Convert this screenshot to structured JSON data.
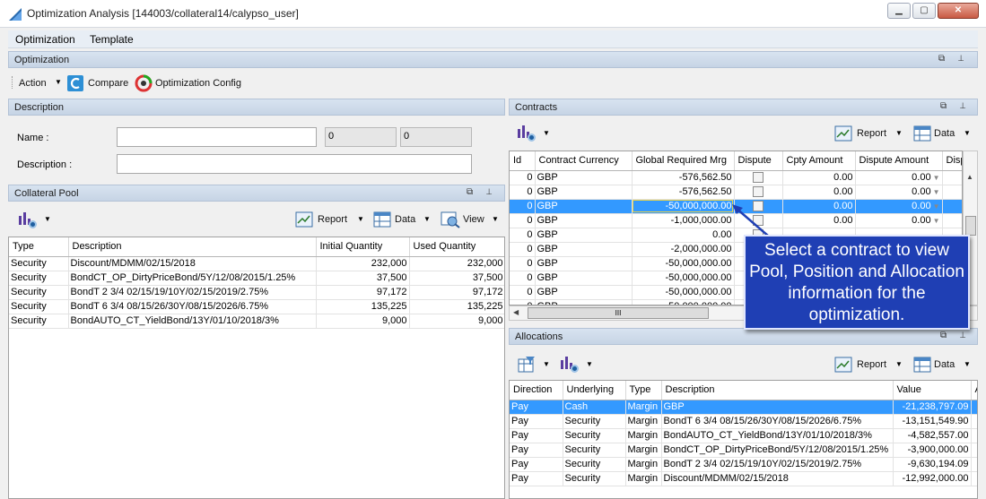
{
  "window": {
    "title": "Optimization Analysis [144003/collateral14/calypso_user]",
    "min_label": "▁",
    "restore_label": "▢",
    "close_label": "✕"
  },
  "menu": [
    "Optimization",
    "Template"
  ],
  "optimization_panel": {
    "header": "Optimization",
    "action_label": "Action",
    "compare_label": "Compare",
    "config_label": "Optimization Config"
  },
  "description_panel": {
    "header": "Description",
    "name_label": "Name :",
    "name_value": "",
    "field_a": "0",
    "field_b": "0",
    "description_label": "Description :",
    "description_value": ""
  },
  "collateral_pool": {
    "header": "Collateral Pool",
    "report_label": "Report",
    "data_label": "Data",
    "view_label": "View",
    "columns": [
      "Type",
      "Description",
      "Initial Quantity",
      "Used Quantity"
    ],
    "rows": [
      [
        "Security",
        "Discount/MDMM/02/15/2018",
        "232,000",
        "232,000"
      ],
      [
        "Security",
        "BondCT_OP_DirtyPriceBond/5Y/12/08/2015/1.25%",
        "37,500",
        "37,500"
      ],
      [
        "Security",
        "BondT 2 3/4 02/15/19/10Y/02/15/2019/2.75%",
        "97,172",
        "97,172"
      ],
      [
        "Security",
        "BondT 6 3/4 08/15/26/30Y/08/15/2026/6.75%",
        "135,225",
        "135,225"
      ],
      [
        "Security",
        "BondAUTO_CT_YieldBond/13Y/01/10/2018/3%",
        "9,000",
        "9,000"
      ]
    ]
  },
  "contracts": {
    "header": "Contracts",
    "report_label": "Report",
    "data_label": "Data",
    "columns": [
      "Id",
      "Contract Currency",
      "Global Required Mrg",
      "Dispute",
      "Cpty Amount",
      "Dispute Amount",
      "Disp"
    ],
    "rows": [
      [
        "0",
        "GBP",
        "-576,562.50",
        "",
        "0.00",
        "0.00"
      ],
      [
        "0",
        "GBP",
        "-576,562.50",
        "",
        "0.00",
        "0.00"
      ],
      [
        "0",
        "GBP",
        "-50,000,000.00",
        "",
        "0.00",
        "0.00"
      ],
      [
        "0",
        "GBP",
        "-1,000,000.00",
        "",
        "0.00",
        "0.00"
      ],
      [
        "0",
        "GBP",
        "0.00",
        "",
        "",
        ""
      ],
      [
        "0",
        "GBP",
        "-2,000,000.00",
        "",
        "",
        ""
      ],
      [
        "0",
        "GBP",
        "-50,000,000.00",
        "",
        "",
        ""
      ],
      [
        "0",
        "GBP",
        "-50,000,000.00",
        "",
        "",
        ""
      ],
      [
        "0",
        "GBP",
        "-50,000,000.00",
        "",
        "",
        ""
      ],
      [
        "0",
        "GBP",
        "-50,000,000.00",
        "",
        "",
        ""
      ]
    ],
    "selected_row": 2,
    "hscroll_grip": "III"
  },
  "callout": {
    "text": "Select a contract to view Pool, Position and Allocation information for the optimization."
  },
  "allocations": {
    "header": "Allocations",
    "report_label": "Report",
    "data_label": "Data",
    "columns": [
      "Direction",
      "Underlying",
      "Type",
      "Description",
      "Value",
      "A"
    ],
    "rows": [
      [
        "Pay",
        "Cash",
        "Margin",
        "GBP",
        "-21,238,797.09"
      ],
      [
        "Pay",
        "Security",
        "Margin",
        "BondT 6 3/4 08/15/26/30Y/08/15/2026/6.75%",
        "-13,151,549.90"
      ],
      [
        "Pay",
        "Security",
        "Margin",
        "BondAUTO_CT_YieldBond/13Y/01/10/2018/3%",
        "-4,582,557.00"
      ],
      [
        "Pay",
        "Security",
        "Margin",
        "BondCT_OP_DirtyPriceBond/5Y/12/08/2015/1.25%",
        "-3,900,000.00"
      ],
      [
        "Pay",
        "Security",
        "Margin",
        "BondT 2 3/4 02/15/19/10Y/02/15/2019/2.75%",
        "-9,630,194.09"
      ],
      [
        "Pay",
        "Security",
        "Margin",
        "Discount/MDMM/02/15/2018",
        "-12,992,000.00"
      ]
    ],
    "selected_row": 0
  },
  "colors": {
    "selection": "#3399ff",
    "callout_bg": "#1f3fb4",
    "header_bg": "#c6d4e5"
  }
}
